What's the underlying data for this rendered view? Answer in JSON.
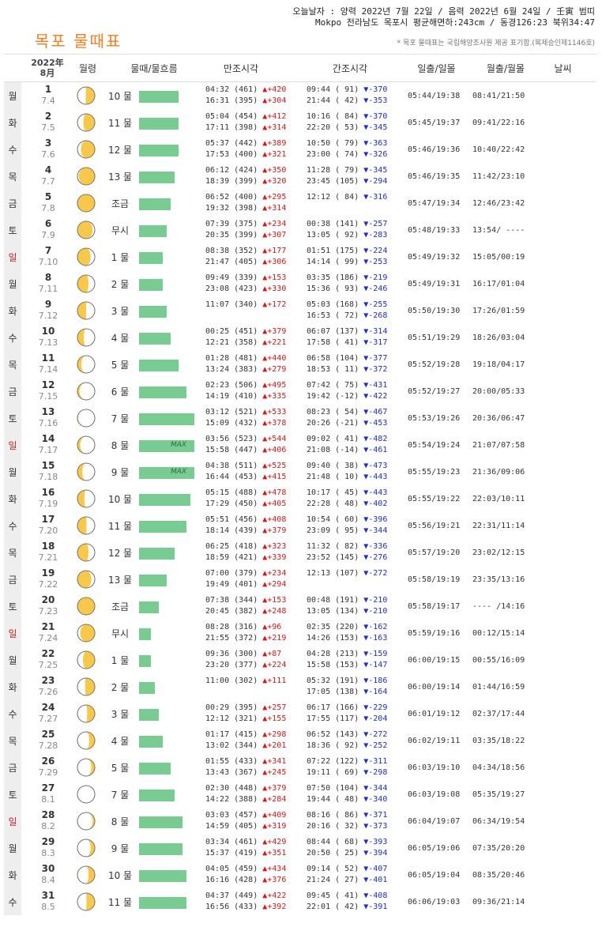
{
  "info": {
    "line1": "오늘날자 : 양력 2022년 7월 22일 / 음력 2022년 6월 24일 / 壬寅 범띠",
    "line2": "Mokpo 전라남도 목포시 평균해면하:243cm / 동경126:23 북위34:47"
  },
  "title": "목포 물때표",
  "note": "* 목포 물때표는 국립해양조사원 제공 표기함.(복제승인제1146호)",
  "header": {
    "year": "2022年",
    "month": "8月",
    "moon": "월령",
    "tide": "물때/물흐름",
    "high": "만조시각",
    "low": "간조시각",
    "sun": "일출/일몰",
    "moonrise": "월출/월몰",
    "weather": "날씨"
  },
  "colors": {
    "title": "#f07c1c",
    "bar": "#79cc91",
    "rise": "#d21818",
    "fall": "#1a2ec8",
    "sunday": "#d42020"
  },
  "rows": [
    {
      "wk": "월",
      "day": "1",
      "lunar": "7.4",
      "mul": "10 물",
      "bar": 0.71,
      "max": false,
      "ph": 0.26,
      "high": [
        "04:32 (461) ▲+420",
        "16:31 (395) ▲+304"
      ],
      "low": [
        "09:44 ( 91) ▼-370",
        "21:44 ( 42) ▼-353"
      ],
      "sun": "05:44/19:38",
      "moon": "08:41/21:50"
    },
    {
      "wk": "화",
      "day": "2",
      "lunar": "7.5",
      "mul": "11 물",
      "bar": 0.71,
      "max": false,
      "ph": 0.33,
      "high": [
        "05:04 (454) ▲+412",
        "17:11 (398) ▲+314"
      ],
      "low": [
        "10:16 ( 84) ▼-370",
        "22:20 ( 53) ▼-345"
      ],
      "sun": "05:45/19:37",
      "moon": "09:41/22:16"
    },
    {
      "wk": "수",
      "day": "3",
      "lunar": "7.6",
      "mul": "12 물",
      "bar": 0.71,
      "max": false,
      "ph": 0.4,
      "high": [
        "05:37 (442) ▲+389",
        "17:53 (400) ▲+321"
      ],
      "low": [
        "10:50 ( 79) ▼-363",
        "23:00 ( 74) ▼-326"
      ],
      "sun": "05:46/19:36",
      "moon": "10:40/22:42"
    },
    {
      "wk": "목",
      "day": "4",
      "lunar": "7.7",
      "mul": "13 물",
      "bar": 0.64,
      "max": false,
      "ph": 0.46,
      "high": [
        "06:12 (424) ▲+350",
        "18:39 (399) ▲+320"
      ],
      "low": [
        "11:28 ( 79) ▼-345",
        "23:45 (105) ▼-294"
      ],
      "sun": "05:46/19:35",
      "moon": "11:42/23:10"
    },
    {
      "wk": "금",
      "day": "5",
      "lunar": "7.8",
      "mul": "조금",
      "bar": 0.57,
      "max": false,
      "ph": 0.5,
      "high": [
        "06:52 (400) ▲+295",
        "19:32 (398) ▲+314"
      ],
      "low": [
        "12:12 ( 84) ▼-316",
        ""
      ],
      "sun": "05:47/19:34",
      "moon": "12:46/23:42"
    },
    {
      "wk": "토",
      "day": "6",
      "lunar": "7.9",
      "mul": "무시",
      "bar": 0.5,
      "max": false,
      "ph": 0.56,
      "high": [
        "07:39 (375) ▲+234",
        "20:35 (399) ▲+307"
      ],
      "low": [
        "00:38 (141) ▼-257",
        "13:05 ( 92) ▼-283"
      ],
      "sun": "05:48/19:33",
      "moon": "13:54/ ----"
    },
    {
      "wk": "일",
      "day": "7",
      "lunar": "7.10",
      "mul": "1 물",
      "bar": 0.43,
      "max": false,
      "ph": 0.62,
      "high": [
        "08:38 (352) ▲+177",
        "21:47 (405) ▲+306"
      ],
      "low": [
        "01:51 (175) ▼-224",
        "14:14 ( 99) ▼-253"
      ],
      "sun": "05:49/19:32",
      "moon": "15:05/00:19"
    },
    {
      "wk": "월",
      "day": "8",
      "lunar": "7.11",
      "mul": "2 물",
      "bar": 0.43,
      "max": false,
      "ph": 0.68,
      "high": [
        "09:49 (339) ▲+153",
        "23:08 (423) ▲+330"
      ],
      "low": [
        "03:35 (186) ▼-219",
        "15:36 ( 93) ▼-246"
      ],
      "sun": "05:49/19:31",
      "moon": "16:17/01:04"
    },
    {
      "wk": "화",
      "day": "9",
      "lunar": "7.12",
      "mul": "3 물",
      "bar": 0.5,
      "max": false,
      "ph": 0.75,
      "high": [
        "11:07 (340) ▲+172",
        ""
      ],
      "low": [
        "05:03 (168) ▼-255",
        "16:53 ( 72) ▼-268"
      ],
      "sun": "05:50/19:30",
      "moon": "17:26/01:59"
    },
    {
      "wk": "수",
      "day": "10",
      "lunar": "7.13",
      "mul": "4 물",
      "bar": 0.57,
      "max": false,
      "ph": 0.82,
      "high": [
        "00:25 (451) ▲+379",
        "12:21 (358) ▲+221"
      ],
      "low": [
        "06:07 (137) ▼-314",
        "17:58 ( 41) ▼-317"
      ],
      "sun": "05:51/19:29",
      "moon": "18:26/03:04"
    },
    {
      "wk": "목",
      "day": "11",
      "lunar": "7.14",
      "mul": "5 물",
      "bar": 0.71,
      "max": false,
      "ph": 0.89,
      "high": [
        "01:28 (481) ▲+440",
        "13:24 (383) ▲+279"
      ],
      "low": [
        "06:58 (104) ▼-377",
        "18:53 ( 11) ▼-372"
      ],
      "sun": "05:52/19:28",
      "moon": "19:18/04:17"
    },
    {
      "wk": "금",
      "day": "12",
      "lunar": "7.15",
      "mul": "6 물",
      "bar": 0.86,
      "max": false,
      "ph": 0.94,
      "high": [
        "02:23 (506) ▲+495",
        "14:19 (410) ▲+335"
      ],
      "low": [
        "07:42 ( 75) ▼-431",
        "19:42 (-12) ▼-422"
      ],
      "sun": "05:52/19:27",
      "moon": "20:00/05:33"
    },
    {
      "wk": "토",
      "day": "13",
      "lunar": "7.16",
      "mul": "7 물",
      "bar": 1.0,
      "max": false,
      "ph": 0.98,
      "high": [
        "03:12 (521) ▲+533",
        "15:09 (432) ▲+378"
      ],
      "low": [
        "08:23 ( 54) ▼-467",
        "20:26 (-21) ▼-453"
      ],
      "sun": "05:53/19:26",
      "moon": "20:36/06:47"
    },
    {
      "wk": "일",
      "day": "14",
      "lunar": "7.17",
      "mul": "8 물",
      "bar": 1.0,
      "max": true,
      "ph": 0.92,
      "high": [
        "03:56 (523) ▲+544",
        "15:58 (447) ▲+406"
      ],
      "low": [
        "09:02 ( 41) ▼-482",
        "21:08 (-14) ▼-461"
      ],
      "sun": "05:54/19:24",
      "moon": "21:07/07:58"
    },
    {
      "wk": "월",
      "day": "15",
      "lunar": "7.18",
      "mul": "9 물",
      "bar": 1.0,
      "max": true,
      "ph": 0.86,
      "high": [
        "04:38 (511) ▲+525",
        "16:44 (453) ▲+415"
      ],
      "low": [
        "09:40 ( 38) ▼-473",
        "21:48 ( 10) ▼-443"
      ],
      "sun": "05:55/19:23",
      "moon": "21:36/09:06"
    },
    {
      "wk": "화",
      "day": "16",
      "lunar": "7.19",
      "mul": "10 물",
      "bar": 0.93,
      "max": false,
      "ph": 0.8,
      "high": [
        "05:15 (488) ▲+478",
        "17:29 (450) ▲+405"
      ],
      "low": [
        "10:17 ( 45) ▼-443",
        "22:28 ( 48) ▼-402"
      ],
      "sun": "05:55/19:22",
      "moon": "22:03/10:11"
    },
    {
      "wk": "수",
      "day": "17",
      "lunar": "7.20",
      "mul": "11 물",
      "bar": 0.86,
      "max": false,
      "ph": 0.74,
      "high": [
        "05:51 (456) ▲+408",
        "18:14 (439) ▲+379"
      ],
      "low": [
        "10:54 ( 60) ▼-396",
        "23:09 ( 95) ▼-344"
      ],
      "sun": "05:56/19:21",
      "moon": "22:31/11:14"
    },
    {
      "wk": "목",
      "day": "18",
      "lunar": "7.21",
      "mul": "12 물",
      "bar": 0.64,
      "max": false,
      "ph": 0.68,
      "high": [
        "06:25 (418) ▲+323",
        "18:59 (421) ▲+339"
      ],
      "low": [
        "11:32 ( 82) ▼-336",
        "23:52 (145) ▼-276"
      ],
      "sun": "05:57/19:20",
      "moon": "23:02/12:15"
    },
    {
      "wk": "금",
      "day": "19",
      "lunar": "7.22",
      "mul": "13 물",
      "bar": 0.5,
      "max": false,
      "ph": 0.6,
      "high": [
        "07:00 (379) ▲+234",
        "19:49 (401) ▲+294"
      ],
      "low": [
        "12:13 (107) ▼-272",
        ""
      ],
      "sun": "05:58/19:19",
      "moon": "23:35/13:16"
    },
    {
      "wk": "토",
      "day": "20",
      "lunar": "7.23",
      "mul": "조금",
      "bar": 0.36,
      "max": false,
      "ph": 0.5,
      "high": [
        "07:38 (344) ▲+153",
        "20:45 (382) ▲+248"
      ],
      "low": [
        "00:48 (191) ▼-210",
        "13:05 (134) ▼-210"
      ],
      "sun": "05:58/19:17",
      "moon": "---- /14:16"
    },
    {
      "wk": "일",
      "day": "21",
      "lunar": "7.24",
      "mul": "무시",
      "bar": 0.21,
      "max": false,
      "ph": 0.42,
      "high": [
        "08:28 (316) ▲+96",
        "21:55 (372) ▲+219"
      ],
      "low": [
        "02:35 (220) ▼-162",
        "14:26 (153) ▼-163"
      ],
      "sun": "05:59/19:16",
      "moon": "00:12/15:14"
    },
    {
      "wk": "월",
      "day": "22",
      "lunar": "7.25",
      "mul": "1 물",
      "bar": 0.21,
      "max": false,
      "ph": 0.34,
      "high": [
        "09:36 (300) ▲+87",
        "23:20 (377) ▲+224"
      ],
      "low": [
        "04:28 (213) ▼-159",
        "15:58 (153) ▼-147"
      ],
      "sun": "06:00/19:15",
      "moon": "00:55/16:09"
    },
    {
      "wk": "화",
      "day": "23",
      "lunar": "7.26",
      "mul": "2 물",
      "bar": 0.29,
      "max": false,
      "ph": 0.28,
      "high": [
        "11:00 (302) ▲+111",
        ""
      ],
      "low": [
        "05:32 (191) ▼-186",
        "17:05 (138) ▼-164"
      ],
      "sun": "06:00/19:14",
      "moon": "01:44/16:59"
    },
    {
      "wk": "수",
      "day": "24",
      "lunar": "7.27",
      "mul": "3 물",
      "bar": 0.36,
      "max": false,
      "ph": 0.22,
      "high": [
        "00:29 (395) ▲+257",
        "12:12 (321) ▲+155"
      ],
      "low": [
        "06:17 (166) ▼-229",
        "17:55 (117) ▼-204"
      ],
      "sun": "06:01/19:12",
      "moon": "02:37/17:44"
    },
    {
      "wk": "목",
      "day": "25",
      "lunar": "7.28",
      "mul": "4 물",
      "bar": 0.43,
      "max": false,
      "ph": 0.16,
      "high": [
        "01:17 (415) ▲+298",
        "13:02 (344) ▲+201"
      ],
      "low": [
        "06:52 (143) ▼-272",
        "18:36 ( 92) ▼-252"
      ],
      "sun": "06:02/19:11",
      "moon": "03:35/18:22"
    },
    {
      "wk": "금",
      "day": "26",
      "lunar": "7.29",
      "mul": "5 물",
      "bar": 0.57,
      "max": false,
      "ph": 0.1,
      "high": [
        "01:55 (433) ▲+341",
        "13:43 (367) ▲+245"
      ],
      "low": [
        "07:22 (122) ▼-311",
        "19:11 ( 69) ▼-298"
      ],
      "sun": "06:03/19:10",
      "moon": "04:34/18:56"
    },
    {
      "wk": "토",
      "day": "27",
      "lunar": "8.1",
      "mul": "7 물",
      "bar": 0.64,
      "max": false,
      "ph": 0.0,
      "high": [
        "02:30 (448) ▲+379",
        "14:22 (388) ▲+284"
      ],
      "low": [
        "07:50 (104) ▼-344",
        "19:44 ( 48) ▼-340"
      ],
      "sun": "06:03/19:08",
      "moon": "05:35/19:27"
    },
    {
      "wk": "일",
      "day": "28",
      "lunar": "8.2",
      "mul": "8 물",
      "bar": 0.79,
      "max": false,
      "ph": 0.06,
      "high": [
        "03:03 (457) ▲+409",
        "14:59 (405) ▲+319"
      ],
      "low": [
        "08:16 ( 86) ▼-371",
        "20:16 ( 32) ▼-373"
      ],
      "sun": "06:04/19:07",
      "moon": "06:34/19:54"
    },
    {
      "wk": "월",
      "day": "29",
      "lunar": "8.3",
      "mul": "9 물",
      "bar": 0.79,
      "max": false,
      "ph": 0.12,
      "high": [
        "03:34 (461) ▲+429",
        "15:37 (419) ▲+351"
      ],
      "low": [
        "08:44 ( 68) ▼-393",
        "20:50 ( 25) ▼-394"
      ],
      "sun": "06:05/19:06",
      "moon": "07:35/20:20"
    },
    {
      "wk": "화",
      "day": "30",
      "lunar": "8.4",
      "mul": "10 물",
      "bar": 0.86,
      "max": false,
      "ph": 0.18,
      "high": [
        "04:05 (459) ▲+434",
        "16:16 (428) ▲+376"
      ],
      "low": [
        "09:14 ( 52) ▼-407",
        "21:24 ( 27) ▼-401"
      ],
      "sun": "06:05/19:04",
      "moon": "08:35/20:46"
    },
    {
      "wk": "수",
      "day": "31",
      "lunar": "8.5",
      "mul": "11 물",
      "bar": 0.86,
      "max": false,
      "ph": 0.24,
      "high": [
        "04:37 (449) ▲+422",
        "16:56 (433) ▲+392"
      ],
      "low": [
        "09:45 ( 41) ▼-408",
        "22:01 ( 42) ▼-391"
      ],
      "sun": "06:06/19:03",
      "moon": "09:36/21:14"
    }
  ],
  "max_label": "MAX"
}
